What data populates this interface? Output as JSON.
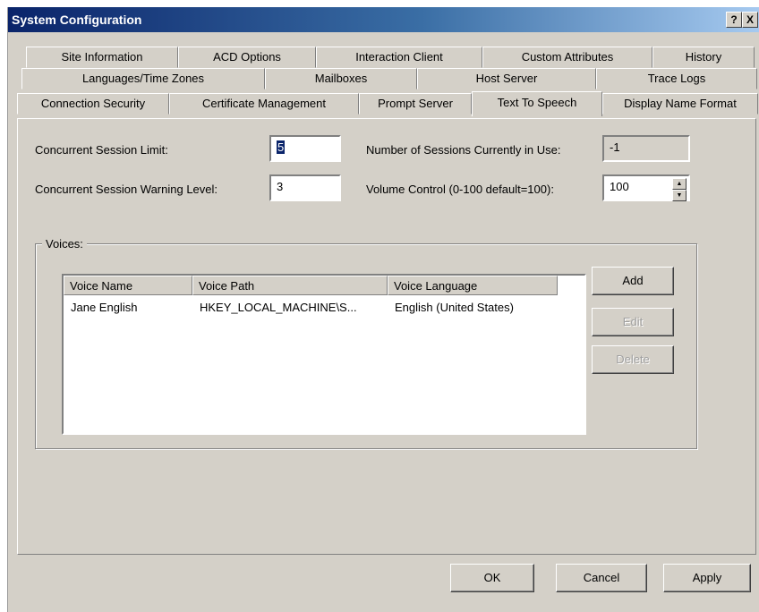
{
  "window": {
    "title": "System Configuration",
    "help_icon_label": "?",
    "close_icon_label": "X"
  },
  "tabs": {
    "row1": [
      "Site Information",
      "ACD Options",
      "Interaction Client",
      "Custom Attributes",
      "History"
    ],
    "row2": [
      "Languages/Time Zones",
      "Mailboxes",
      "Host Server",
      "Trace Logs"
    ],
    "row3": [
      "Connection Security",
      "Certificate Management",
      "Prompt Server",
      "Text To Speech",
      "Display Name Format"
    ],
    "active": "Text To Speech"
  },
  "settings": {
    "concurrent_limit_label": "Concurrent Session Limit:",
    "concurrent_limit_value": "5",
    "warning_level_label": "Concurrent Session Warning Level:",
    "warning_level_value": "3",
    "sessions_in_use_label": "Number of Sessions Currently in Use:",
    "sessions_in_use_value": "-1",
    "volume_label": "Volume Control (0-100 default=100):",
    "volume_value": "100"
  },
  "voices": {
    "group_label": "Voices:",
    "columns": [
      "Voice Name",
      "Voice Path",
      "Voice Language"
    ],
    "rows": [
      {
        "name": "Jane English",
        "path": "HKEY_LOCAL_MACHINE\\S...",
        "language": "English (United States)"
      }
    ],
    "add_label": "Add",
    "edit_label": "Edit",
    "delete_label": "Delete"
  },
  "footer": {
    "ok_label": "OK",
    "cancel_label": "Cancel",
    "apply_label": "Apply"
  }
}
